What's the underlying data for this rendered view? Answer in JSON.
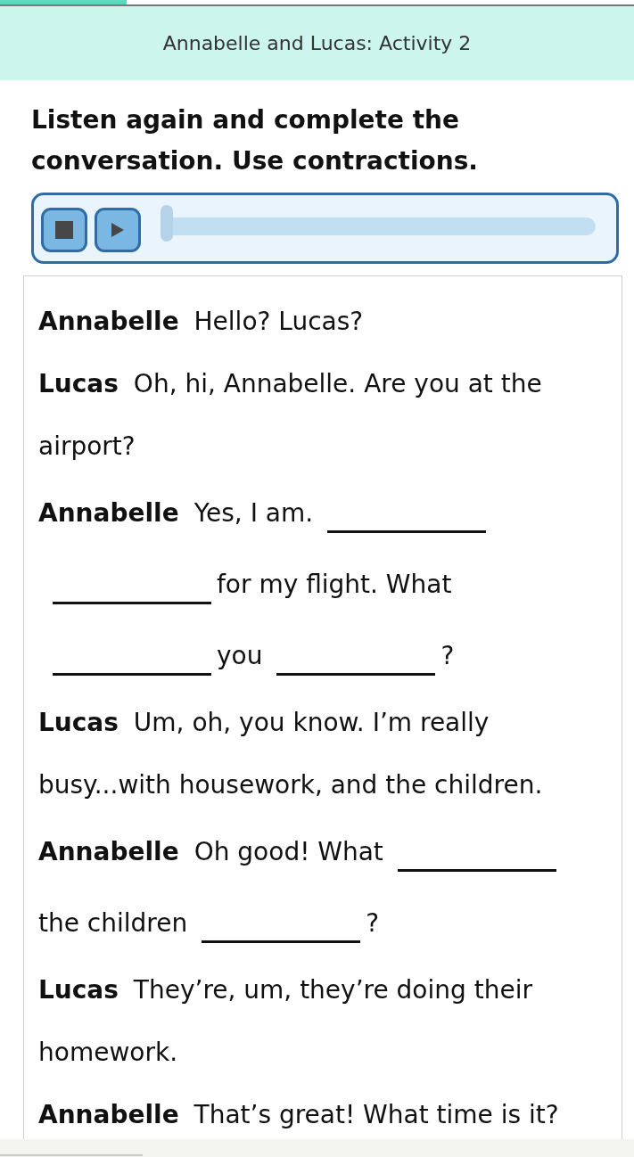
{
  "progress": {
    "level": 0.2
  },
  "header": {
    "title": "Annabelle and Lucas: Activity 2"
  },
  "instruction": "Listen again and complete the conversation. Use contractions.",
  "audio_player": {
    "level": 0
  },
  "conversation": [
    {
      "speaker": "Annabelle",
      "parts": [
        {
          "kind": "text",
          "text": "Hello? Lucas?"
        }
      ]
    },
    {
      "speaker": "Lucas",
      "parts": [
        {
          "kind": "text",
          "text": "Oh, hi, Annabelle. Are you at the airport?"
        }
      ]
    },
    {
      "speaker": "Annabelle",
      "parts": [
        {
          "kind": "text",
          "text": "Yes, I am."
        },
        {
          "kind": "blank"
        },
        {
          "kind": "blank"
        },
        {
          "kind": "text",
          "text": "for my flight. What"
        },
        {
          "kind": "blank"
        },
        {
          "kind": "text",
          "text": "you"
        },
        {
          "kind": "blank"
        },
        {
          "kind": "text",
          "text": "?"
        }
      ]
    },
    {
      "speaker": "Lucas",
      "parts": [
        {
          "kind": "text",
          "text": "Um, oh, you know. I’m really busy...with housework, and the children."
        }
      ]
    },
    {
      "speaker": "Annabelle",
      "parts": [
        {
          "kind": "text",
          "text": "Oh good! What"
        },
        {
          "kind": "blank"
        },
        {
          "kind": "text",
          "text": "the children"
        },
        {
          "kind": "blank"
        },
        {
          "kind": "text",
          "text": "?"
        }
      ]
    },
    {
      "speaker": "Lucas",
      "parts": [
        {
          "kind": "text",
          "text": "They’re, um, they’re doing their homework."
        }
      ]
    },
    {
      "speaker": "Annabelle",
      "parts": [
        {
          "kind": "text",
          "text": "That’s great! What time is it?"
        }
      ]
    }
  ]
}
